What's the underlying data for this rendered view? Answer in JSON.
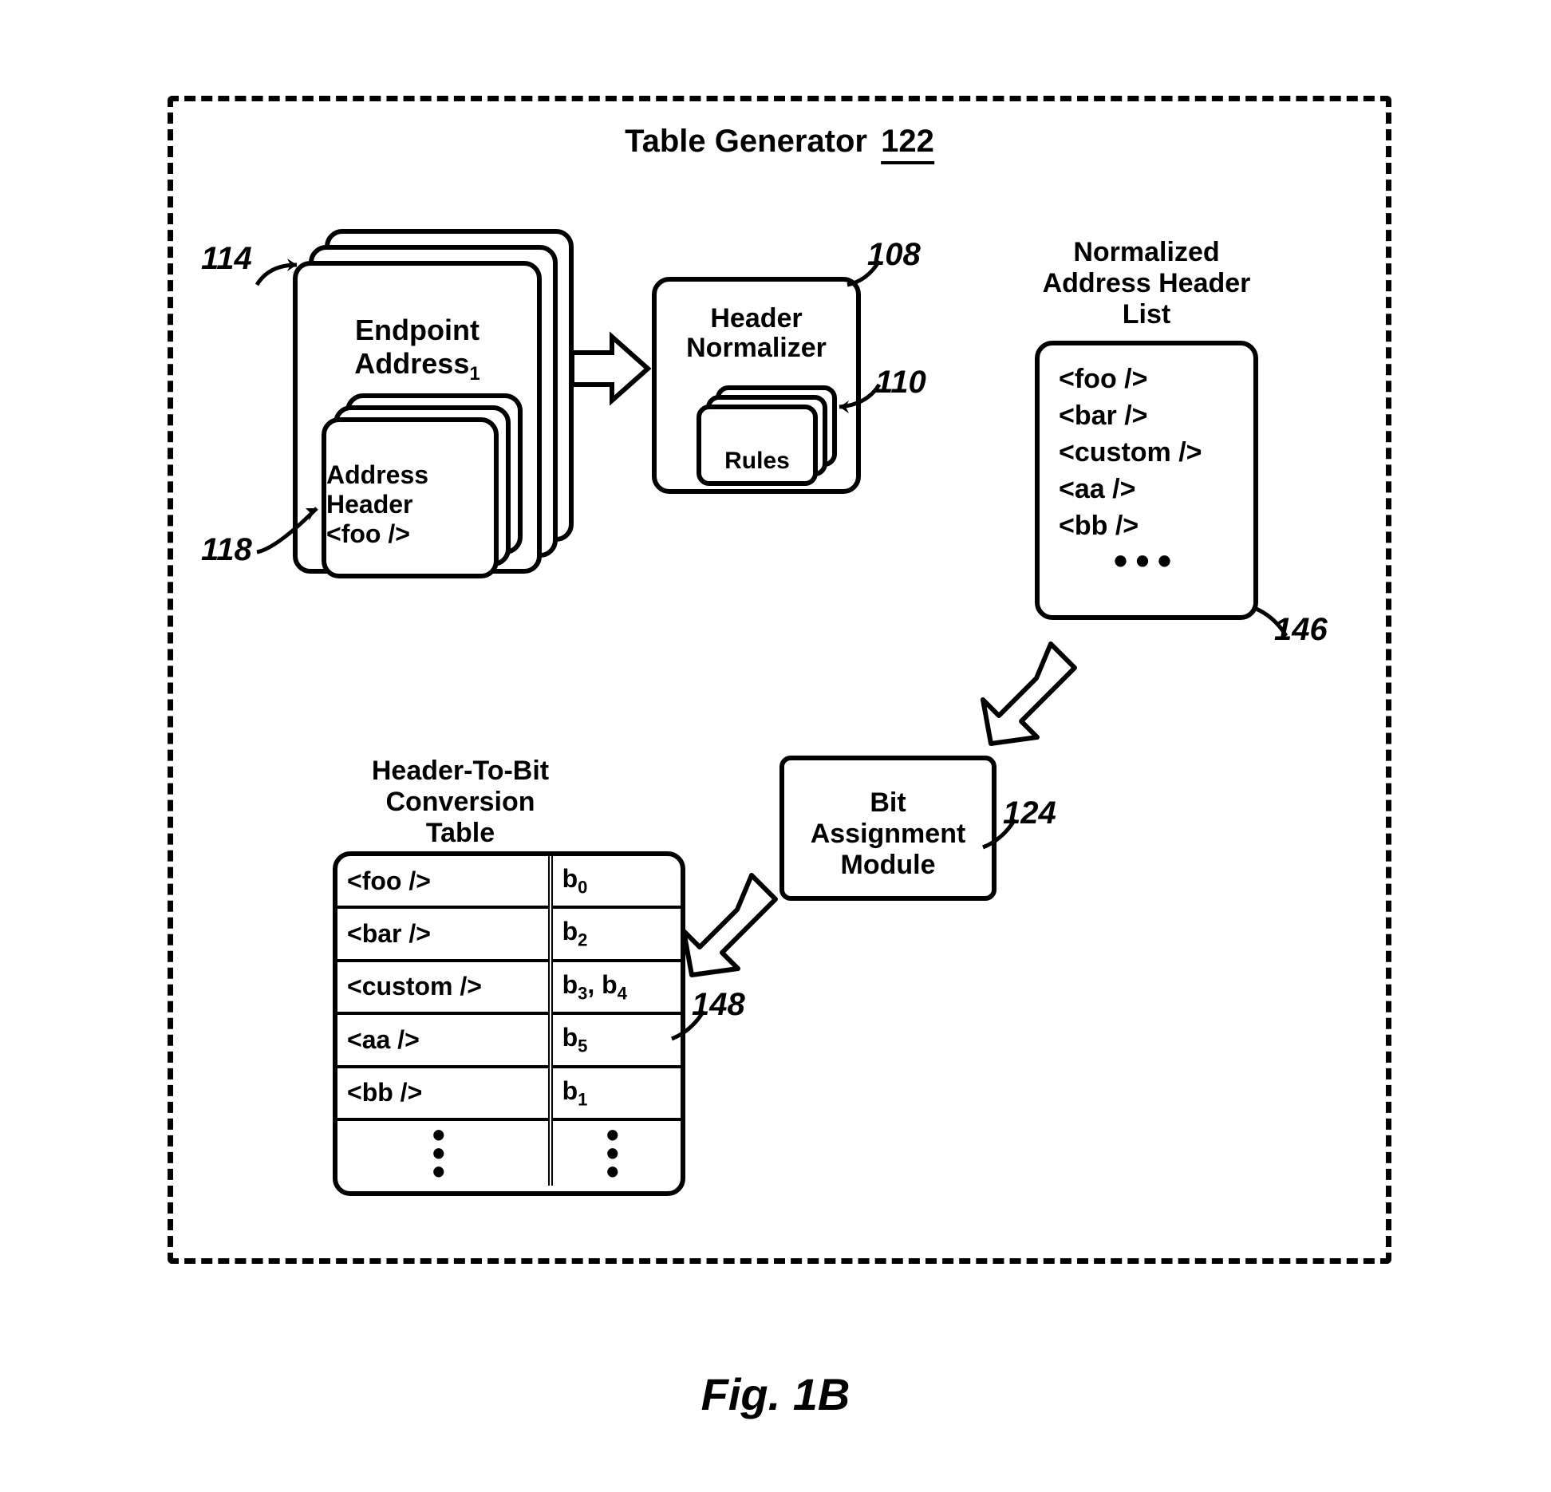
{
  "title_label": "Table Generator",
  "title_num": "122",
  "figure_label": "Fig. 1B",
  "endpoint": {
    "title_line1": "Endpoint",
    "title_line2_prefix": "Address",
    "title_line2_sub": "1",
    "address_header_line1": "Address",
    "address_header_line2": "Header",
    "address_header_line3": "<foo />"
  },
  "normalizer": {
    "line1": "Header",
    "line2": "Normalizer",
    "rules_label": "Rules"
  },
  "normalized_list": {
    "title_l1": "Normalized",
    "title_l2": "Address Header",
    "title_l3": "List",
    "items": [
      "<foo />",
      "<bar />",
      "<custom />",
      "<aa />",
      "<bb />"
    ]
  },
  "bam": {
    "l1": "Bit",
    "l2": "Assignment",
    "l3": "Module"
  },
  "conversion": {
    "title_l1": "Header-To-Bit",
    "title_l2": "Conversion Table",
    "rows": [
      {
        "h": "<foo />",
        "b": "b",
        "s": "0"
      },
      {
        "h": "<bar />",
        "b": "b",
        "s": "2"
      },
      {
        "h": "<custom />",
        "b": "b",
        "s": "3",
        "b2": "b",
        "s2": "4"
      },
      {
        "h": "<aa />",
        "b": "b",
        "s": "5"
      },
      {
        "h": "<bb />",
        "b": "b",
        "s": "1"
      }
    ]
  },
  "refs": {
    "r114": "114",
    "r118": "118",
    "r108": "108",
    "r110": "110",
    "r146": "146",
    "r124": "124",
    "r148": "148"
  }
}
